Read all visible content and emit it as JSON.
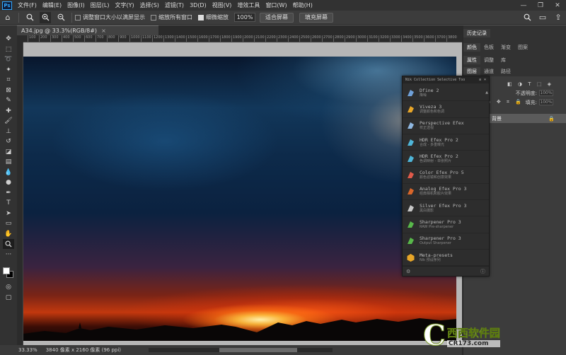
{
  "menu": {
    "logo": "Ps",
    "items": [
      "文件(F)",
      "编辑(E)",
      "图像(I)",
      "图层(L)",
      "文字(Y)",
      "选择(S)",
      "滤镜(T)",
      "3D(D)",
      "视图(V)",
      "增效工具",
      "窗口(W)",
      "帮助(H)"
    ]
  },
  "options": {
    "check1_label": "调整窗口大小以满屏显示",
    "check2_label": "缩放所有窗口",
    "check3_label": "细微缩放",
    "zoom_value": "100%",
    "fit_button": "适合屏幕",
    "fill_button": "填充屏幕"
  },
  "document": {
    "tab_title": "A34.jpg @ 33.3%(RGB/8#)",
    "ruler_ticks": [
      "100",
      "200",
      "300",
      "400",
      "500",
      "600",
      "700",
      "800",
      "900",
      "1000",
      "1100",
      "1200",
      "1300",
      "1400",
      "1500",
      "1600",
      "1700",
      "1800",
      "1900",
      "2000",
      "2100",
      "2200",
      "2300",
      "2400",
      "2500",
      "2600",
      "2700",
      "2800",
      "2900",
      "3000",
      "3100",
      "3200",
      "3300",
      "3400",
      "3500",
      "3600",
      "3700",
      "3800"
    ]
  },
  "status": {
    "zoom": "33.33%",
    "info": "3840 像素 x 2160 像素 (96 ppi)"
  },
  "panels": {
    "history_tab": "历史记录",
    "color_tabs": [
      "颜色",
      "色板",
      "渐变",
      "图案"
    ],
    "prop_tabs": [
      "属性",
      "调整",
      "库"
    ],
    "layer_tabs": [
      "图层",
      "通道",
      "路径"
    ],
    "opacity_label": "不透明度:",
    "opacity_value": "100%",
    "fill_label": "填充:",
    "fill_value": "100%",
    "layer_name": "背景"
  },
  "nik": {
    "title": "Nik Collection Selective Too",
    "items": [
      {
        "name": "Dfine 2",
        "sub": "降噪",
        "color": "#6fa0d8"
      },
      {
        "name": "Viveza 3",
        "sub": "调整颜色和色调",
        "color": "#e8a628"
      },
      {
        "name": "Perspective Efex",
        "sub": "校正透视",
        "color": "#8fb7e0"
      },
      {
        "name": "HDR Efex Pro 2",
        "sub": "合成 - 多重曝光",
        "color": "#4fb6d9"
      },
      {
        "name": "HDR Efex Pro 2",
        "sub": "色调映射 - 单张照片",
        "color": "#4fb6d9"
      },
      {
        "name": "Color Efex Pro 5",
        "sub": "颜色滤镜和创意效果",
        "color": "#e05a4a"
      },
      {
        "name": "Analog Efex Pro 3",
        "sub": "经典相机和胶片效果",
        "color": "#d9662a"
      },
      {
        "name": "Silver Efex Pro 3",
        "sub": "黑白摄影",
        "color": "#c8c8c8"
      },
      {
        "name": "Sharpener Pro 3",
        "sub": "RAW Pre-sharpener",
        "color": "#58b84a"
      },
      {
        "name": "Sharpener Pro 3",
        "sub": "Output Sharpener",
        "color": "#58b84a"
      },
      {
        "name": "Meta-presets",
        "sub": "Nik 预设序列",
        "color": "#e8a628"
      }
    ]
  },
  "watermark": {
    "letter": "C",
    "cn": "西西软件园",
    "url": "CR173.com"
  }
}
